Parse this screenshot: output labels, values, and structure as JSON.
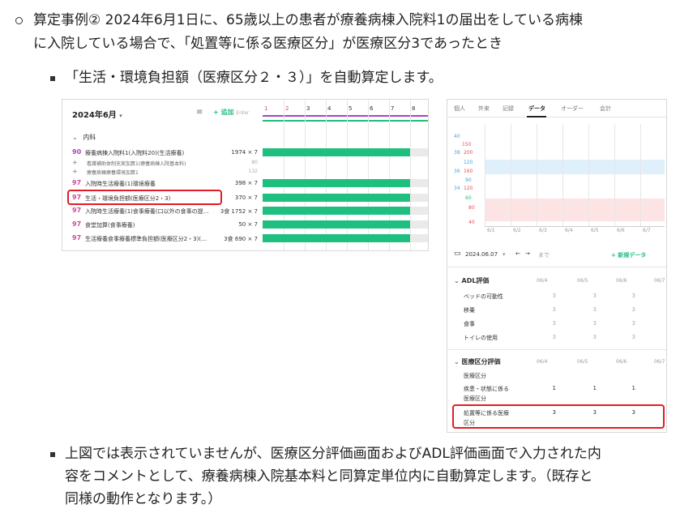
{
  "intro": {
    "line1": "算定事例② 2024年6月1日に、65歳以上の患者が療養病棟入院料1の届出をしている病棟",
    "line2": "に入院している場合で、「処置等に係る医療区分」が医療区分3であったとき"
  },
  "sub_bullet": "「生活・環境負担額（医療区分２・３）」を自動算定します。",
  "left_panel": {
    "month": "2024年6月",
    "add_label": "+ 追加",
    "add_hint": "Enter",
    "day_headers": [
      "1",
      "2",
      "3",
      "4",
      "5",
      "6",
      "7",
      "8"
    ],
    "section": "内科",
    "rows": [
      {
        "code": "90",
        "name": "療養病棟入院料1(入院料20)(生活療養)",
        "qty": "1974 × 7",
        "bar": true
      },
      {
        "code": "+",
        "name": "看護補助体制充実加算1(療養病棟入院基本料)",
        "qty": "80",
        "bar": false
      },
      {
        "code": "+",
        "name": "療養病棟療養環境加算1",
        "qty": "132",
        "bar": false
      },
      {
        "code": "97",
        "name": "入院時生活療養(1)環境療養",
        "qty": "398 × 7",
        "bar": true
      },
      {
        "code": "97",
        "name": "生活・環境負担額(医療区分2・3)",
        "qty": "370 × 7",
        "bar": true
      },
      {
        "code": "97",
        "name": "入院時生活療養(1)食事療養(口以外の食事の提…",
        "qty": "3食  1752 × 7",
        "bar": true
      },
      {
        "code": "97",
        "name": "食堂加算(食事療養)",
        "qty": "50 × 7",
        "bar": true
      },
      {
        "code": "97",
        "name": "生活療養食事療養標準負担額(医療区分2・3)(…",
        "qty": "3食  690 × 7",
        "bar": true
      }
    ],
    "bar_value": "1"
  },
  "right_panel": {
    "tabs": [
      "個人",
      "外来",
      "記録",
      "データ",
      "オーダー",
      "会計"
    ],
    "active_tab": "データ",
    "y_axis_a": [
      "40",
      "38",
      "36",
      "34"
    ],
    "y_axis_b": [
      "150",
      "200",
      "120",
      "160",
      "90",
      "120",
      "60",
      "80",
      "40"
    ],
    "y_axis_c": [
      "40"
    ],
    "x_dates": [
      "6/1",
      "6/2",
      "6/3",
      "6/4",
      "6/5",
      "6/6",
      "6/7"
    ],
    "date_value": "2024.06.07",
    "until": "まで",
    "new_data": "+ 新規データ",
    "adl_title": "ADL評価",
    "col_dates": [
      "06/4",
      "06/5",
      "06/6",
      "06/7"
    ],
    "adl_rows": [
      {
        "label": "ベッドの可動性",
        "values": [
          "3",
          "3",
          "3",
          "3"
        ]
      },
      {
        "label": "移乗",
        "values": [
          "3",
          "3",
          "3",
          "3"
        ]
      },
      {
        "label": "食事",
        "values": [
          "3",
          "3",
          "3",
          "3"
        ]
      },
      {
        "label": "トイレの使用",
        "values": [
          "3",
          "3",
          "3",
          "3"
        ]
      }
    ],
    "med_title": "医療区分評価",
    "med_sub": "医療区分",
    "med_rows": [
      {
        "label1": "疾患・状態に係る",
        "label2": "医療区分",
        "values": [
          "1",
          "1",
          "1",
          "1"
        ]
      },
      {
        "label1": "処置等に係る医療",
        "label2": "区分",
        "values": [
          "3",
          "3",
          "3",
          "3"
        ]
      }
    ]
  },
  "bottom": {
    "line1": "上図では表示されていませんが、医療区分評価画面およびADL評価画面で入力された内",
    "line2": "容をコメントとして、療養病棟入院基本料と同算定単位内に自動算定します。（既存と",
    "line3": "同様の動作となります。）"
  },
  "colors": {
    "green": "#1fbf7f",
    "red": "#e21c24",
    "purple": "#b040c0",
    "code": "#d04a9a"
  }
}
